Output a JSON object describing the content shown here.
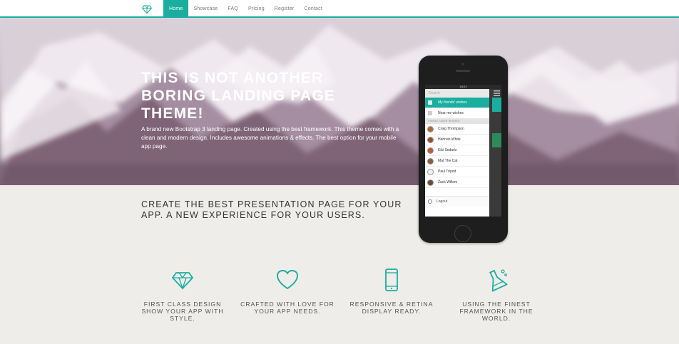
{
  "nav": {
    "logo_icon": "diamond-icon",
    "items": [
      {
        "label": "Home",
        "active": true
      },
      {
        "label": "Showcase",
        "active": false
      },
      {
        "label": "FAQ",
        "active": false
      },
      {
        "label": "Pricing",
        "active": false
      },
      {
        "label": "Register",
        "active": false
      },
      {
        "label": "Contact",
        "active": false
      }
    ]
  },
  "hero": {
    "title": "THIS IS NOT ANOTHER BORING LANDING PAGE THEME!",
    "text": "A brand new Bootstrap 3 landing page. Created using the best framework. This theme comes with a clean and modern design. Includes awesome animations & effects. The best option for your mobile app page."
  },
  "tagline": "CREATE THE BEST PRESENTATION PAGE FOR YOUR APP. A NEW EXPERIENCE FOR YOUR USERS.",
  "phone": {
    "status_time": "19:21",
    "search_placeholder": "Search",
    "menu": [
      {
        "label": "My friends' wishes",
        "active": true
      },
      {
        "label": "Near me wishes",
        "active": false
      }
    ],
    "section_label": "SINGLE USER WISHES",
    "friends": [
      {
        "name": "Craig Thompson",
        "color": "#b5653b"
      },
      {
        "name": "Hannah White",
        "color": "#9a4d2f"
      },
      {
        "name": "Kiki Sedaris",
        "color": "#c2592c"
      },
      {
        "name": "Mat The Cat",
        "color": "#8c5a3e"
      },
      {
        "name": "Paul Tripod",
        "color": "#f0f0f0"
      },
      {
        "name": "Zack Willem",
        "color": "#6b4a36"
      }
    ],
    "logout_label": "Logout"
  },
  "features": [
    {
      "icon": "diamond-icon",
      "label": "FIRST CLASS DESIGN SHOW YOUR APP WITH STYLE."
    },
    {
      "icon": "heart-icon",
      "label": "CRAFTED WITH LOVE FOR YOUR APP NEEDS."
    },
    {
      "icon": "phone-icon",
      "label": "RESPONSIVE & RETINA DISPLAY READY."
    },
    {
      "icon": "flask-icon",
      "label": "USING THE FINEST FRAMEWORK IN THE WORLD."
    }
  ],
  "colors": {
    "accent": "#1aae9f",
    "background": "#efede9"
  }
}
